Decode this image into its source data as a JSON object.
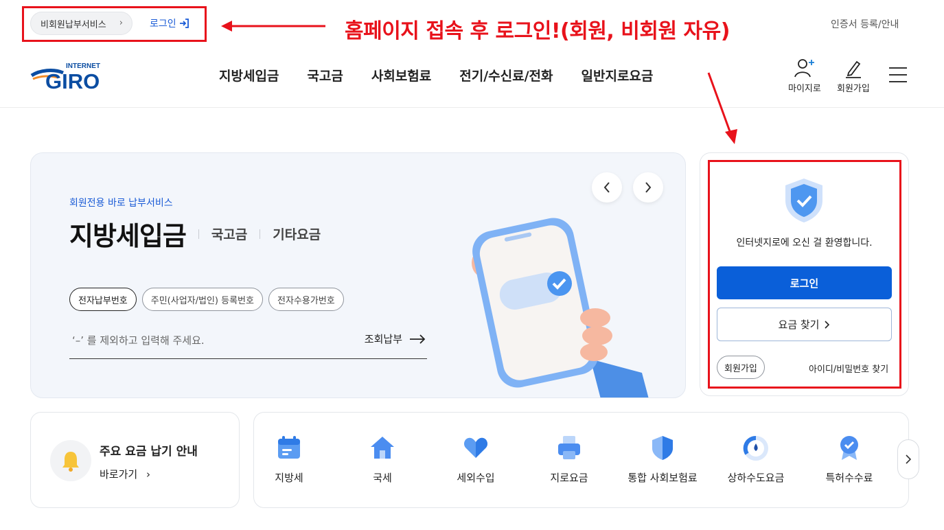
{
  "topbar": {
    "nonmember_label": "비회원납부서비스",
    "login_label": "로그인",
    "annotation_text": "홈페이지 접속 후 로그인!(회원, 비회원 자유)",
    "cert_link": "인증서 등록/안내"
  },
  "header": {
    "logo_top": "INTERNET",
    "logo_main": "GIRO",
    "nav": [
      "지방세입금",
      "국고금",
      "사회보험료",
      "전기/수신료/전화",
      "일반지로요금"
    ],
    "my_label": "마이지로",
    "join_label": "회원가입"
  },
  "hero": {
    "subtitle": "회원전용 바로 납부서비스",
    "main_tab": "지방세입금",
    "tab2": "국고금",
    "tab3": "기타요금",
    "chips": [
      "전자납부번호",
      "주민(사업자/법인) 등록번호",
      "전자수용가번호"
    ],
    "input_placeholder": "‘–’ 를 제외하고 입력해 주세요.",
    "inquiry_label": "조회납부"
  },
  "login_card": {
    "welcome": "인터넷지로에 오신 걸 환영합니다.",
    "login_button": "로그인",
    "find_fee_button": "요금 찾기",
    "join_button": "회원가입",
    "find_id_link": "아이디/비밀번호 찾기"
  },
  "notice": {
    "title": "주요 요금 납기 안내",
    "link": "바로가기"
  },
  "services": [
    {
      "label": "지방세",
      "icon": "calendar-icon"
    },
    {
      "label": "국세",
      "icon": "house-icon"
    },
    {
      "label": "세외수입",
      "icon": "heart-icon"
    },
    {
      "label": "지로요금",
      "icon": "printer-icon"
    },
    {
      "label": "통합 사회보험료",
      "icon": "shield-icon"
    },
    {
      "label": "상하수도요금",
      "icon": "gauge-icon"
    },
    {
      "label": "특허수수료",
      "icon": "medal-icon"
    }
  ],
  "colors": {
    "accent_blue": "#0a5fd9",
    "annotation_red": "#e8121b"
  }
}
